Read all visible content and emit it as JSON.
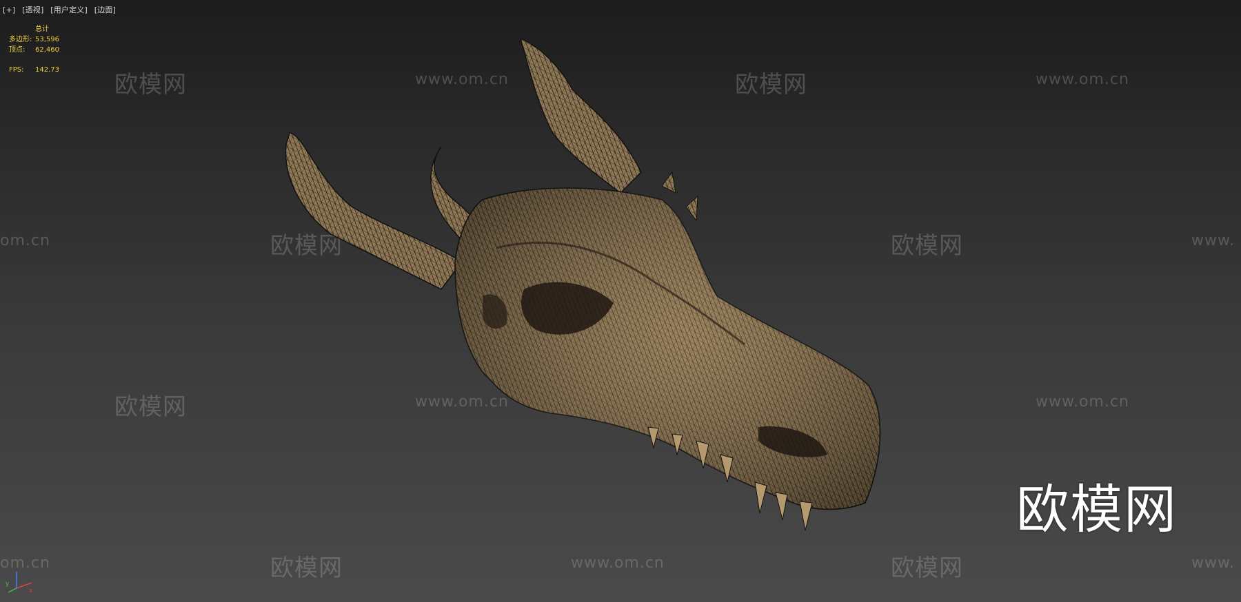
{
  "viewport": {
    "labels": [
      "[+]",
      "[透视]",
      "[用户定义]",
      "[边面]"
    ]
  },
  "stats": {
    "header": "总计",
    "polys_label": "多边形:",
    "polys_value": "53,596",
    "verts_label": "顶点:",
    "verts_value": "62,460",
    "fps_label": "FPS:",
    "fps_value": "142.73"
  },
  "watermark": {
    "cn": "欧模网",
    "url": "www.om.cn",
    "partial_left": "om.cn",
    "partial_right": "www.",
    "big": "欧模网"
  },
  "gizmo": {
    "axes": [
      "x",
      "y",
      "z"
    ],
    "colors": {
      "x": "#e04040",
      "y": "#40c040",
      "z": "#4080ff"
    }
  },
  "colors": {
    "mesh_fill": "#8a7352",
    "mesh_wire": "#1a1410",
    "stats_text": "#f0d246"
  }
}
